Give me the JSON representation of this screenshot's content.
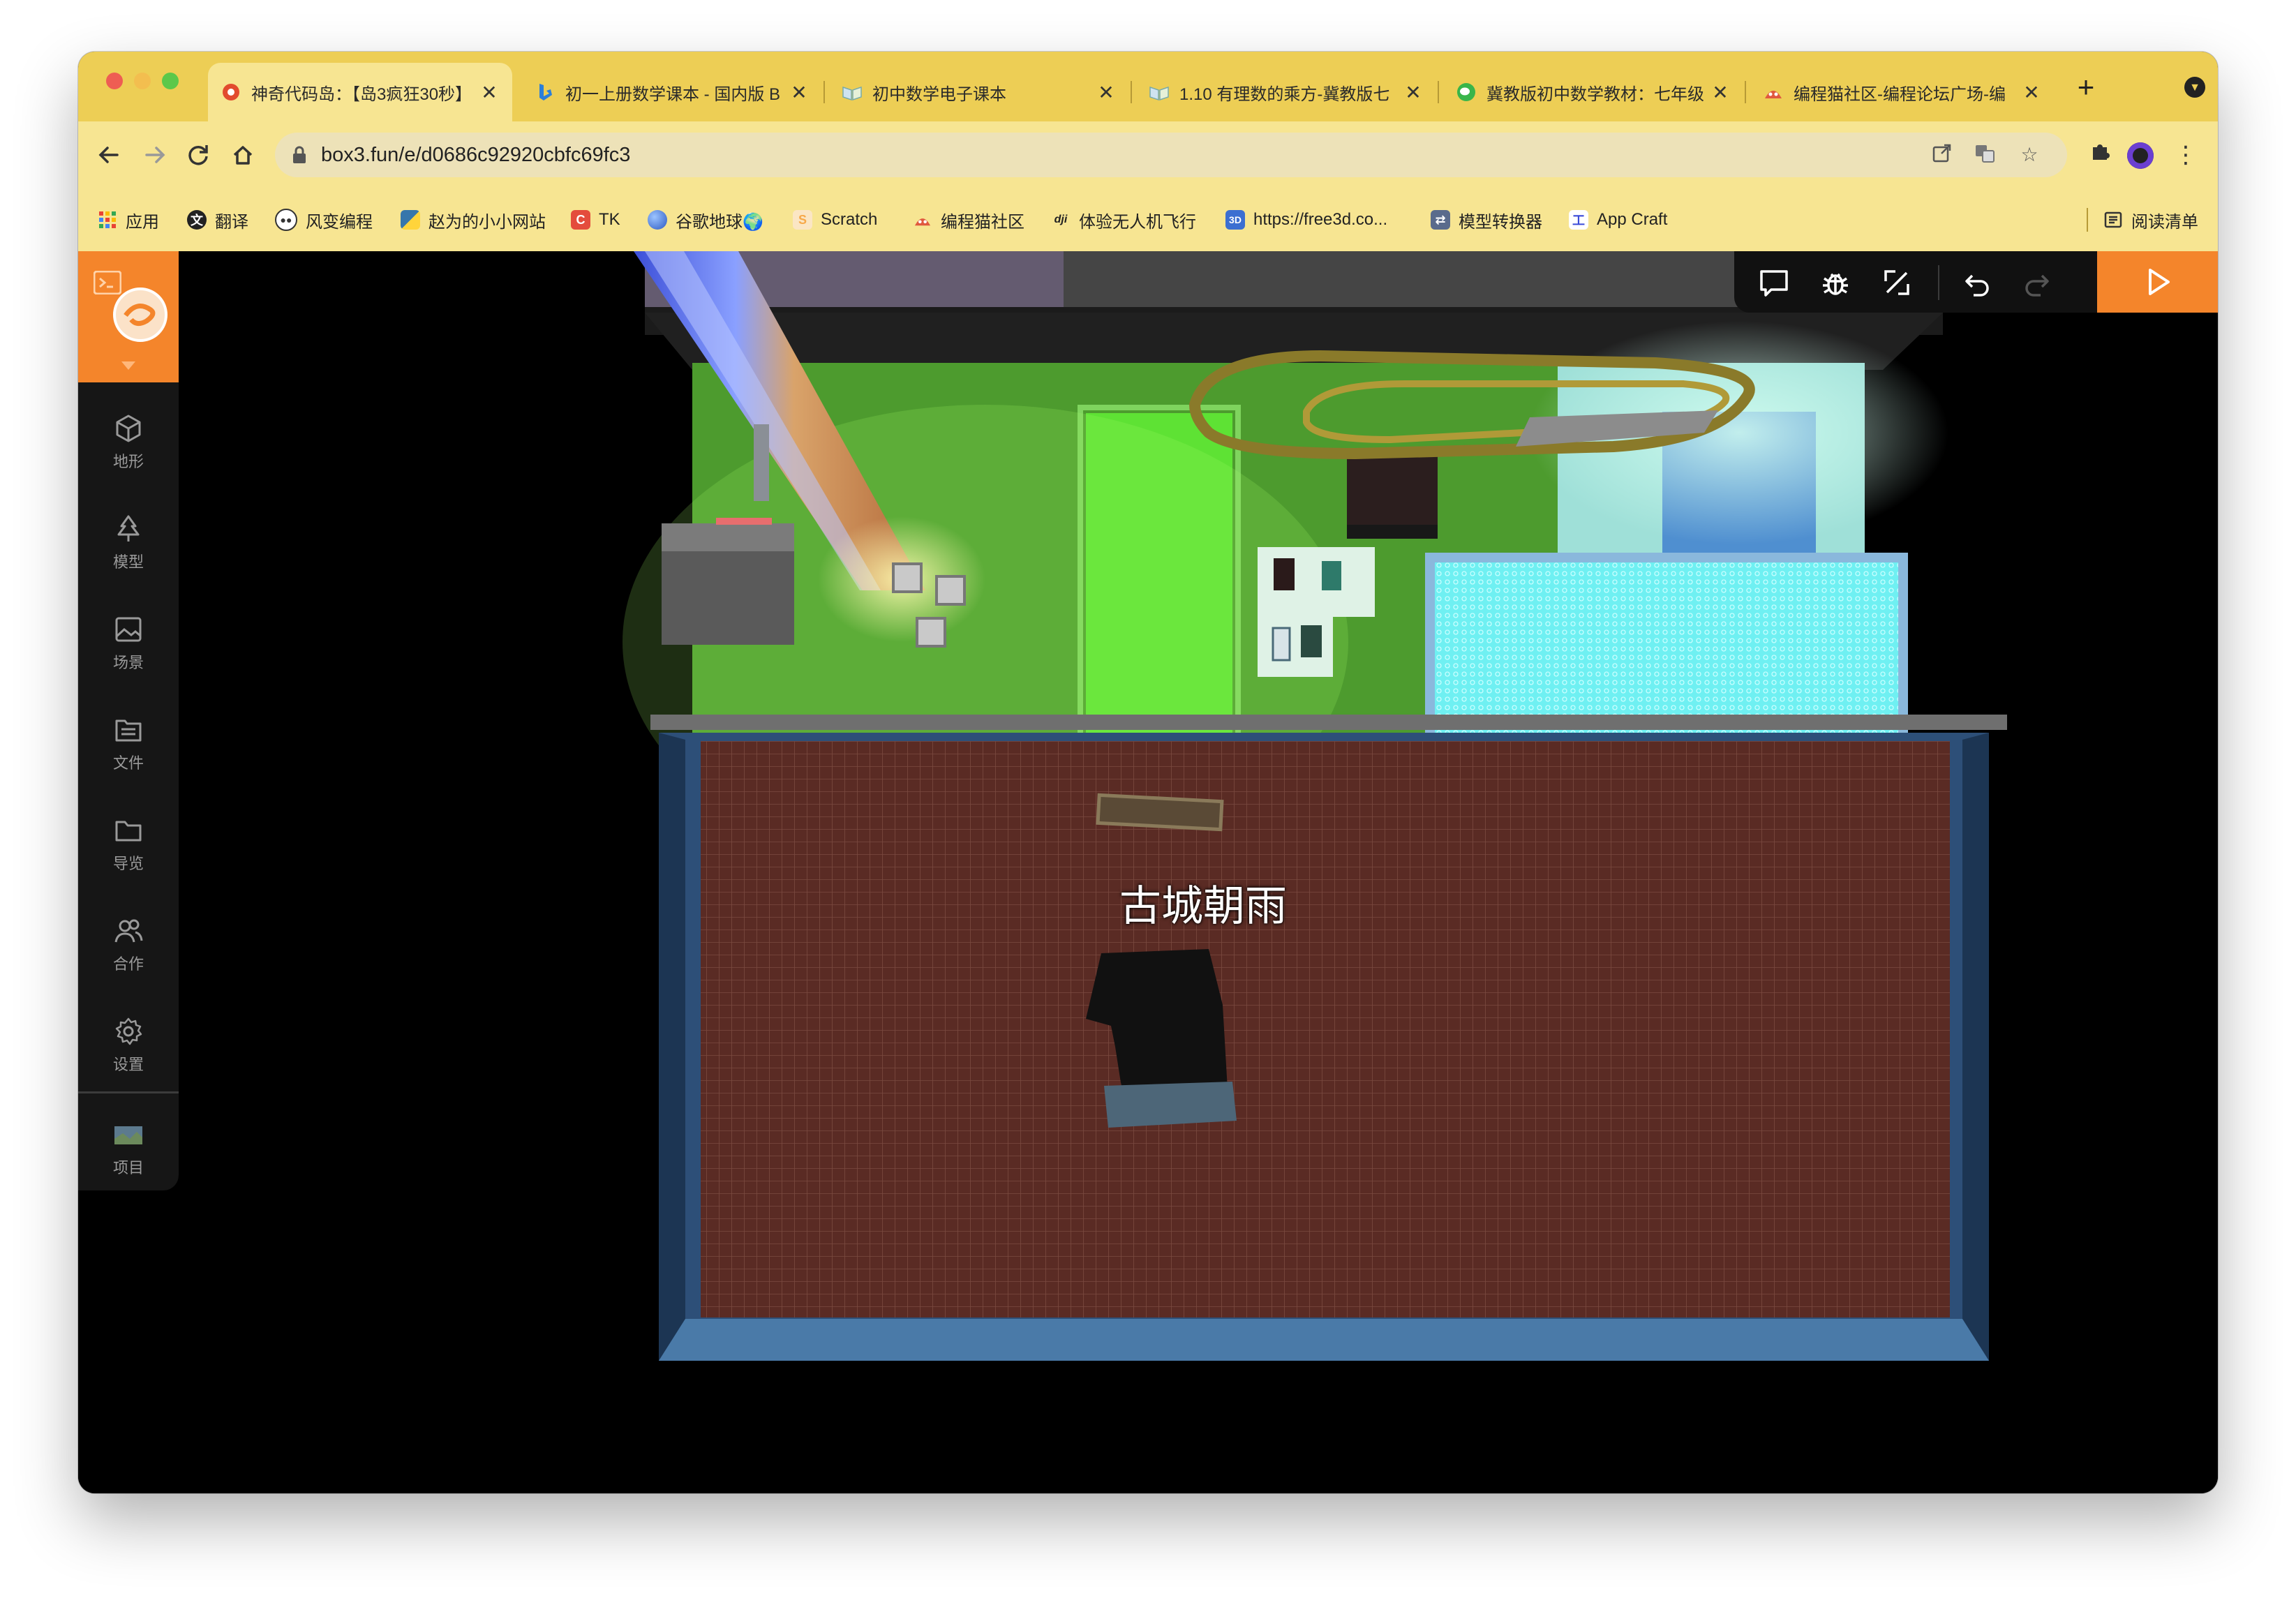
{
  "browser": {
    "tabs": [
      {
        "title": "神奇代码岛：【岛3疯狂30秒】",
        "icon": "gear-flower-icon",
        "active": true
      },
      {
        "title": "初一上册数学课本 - 国内版 B",
        "icon": "bing-icon",
        "active": false
      },
      {
        "title": "初中数学电子课本",
        "icon": "book-icon",
        "active": false
      },
      {
        "title": "1.10 有理数的乘方-冀教版七",
        "icon": "book-icon",
        "active": false
      },
      {
        "title": "冀教版初中数学教材：七年级",
        "icon": "wechat-icon",
        "active": false
      },
      {
        "title": "编程猫社区-编程论坛广场-编",
        "icon": "codemao-icon",
        "active": false
      }
    ],
    "new_tab": "+",
    "url": "box3.fun/e/d0686c92920cbfc69fc3",
    "bookmarks": [
      {
        "label": "应用",
        "icon": "apps-grid-icon",
        "color": "#4285f4"
      },
      {
        "label": "翻译",
        "icon": "translate-icon",
        "color": "#222222"
      },
      {
        "label": "风变编程",
        "icon": "panda-icon",
        "color": "#333333"
      },
      {
        "label": "赵为的小小网站",
        "icon": "python-icon",
        "color": "#3776ab"
      },
      {
        "label": "TK",
        "icon": "c-icon",
        "color": "#e44c3c"
      },
      {
        "label": "谷歌地球🌍",
        "icon": "earth-icon",
        "color": "#3b6fd8"
      },
      {
        "label": "Scratch",
        "icon": "scratch-icon",
        "color": "#f7a94a"
      },
      {
        "label": "编程猫社区",
        "icon": "codemao-icon",
        "color": "#e0593f"
      },
      {
        "label": "体验无人机飞行",
        "icon": "dji-icon",
        "color": "#222222"
      },
      {
        "label": "https://free3d.co...",
        "icon": "free3d-icon",
        "color": "#3c6fd1"
      },
      {
        "label": "模型转换器",
        "icon": "converter-icon",
        "color": "#5a6b8c"
      },
      {
        "label": "App Craft",
        "icon": "appcraft-icon",
        "color": "#3b4bd8"
      }
    ],
    "reading_list": "阅读清单"
  },
  "editor": {
    "sidebar": [
      {
        "label": "地形",
        "icon": "cube-icon"
      },
      {
        "label": "模型",
        "icon": "tree-icon"
      },
      {
        "label": "场景",
        "icon": "image-icon"
      },
      {
        "label": "文件",
        "icon": "file-icon"
      },
      {
        "label": "导览",
        "icon": "folder-icon"
      },
      {
        "label": "合作",
        "icon": "users-icon"
      },
      {
        "label": "设置",
        "icon": "settings-icon"
      },
      {
        "label": "项目",
        "icon": "project-thumbnail-icon"
      }
    ],
    "toolbar": [
      "chat-icon",
      "debug-bug-icon",
      "resize-icon",
      "undo-icon",
      "redo-icon"
    ],
    "run": "play-icon"
  },
  "scene": {
    "player_name": "古城朝雨"
  },
  "colors": {
    "chrome_bar": "#edce55",
    "chrome_toolbar": "#f7e592",
    "accent": "#f4852b",
    "sidebar_bg": "#161616",
    "floor": "#5a2b24",
    "grass": "#5fcc3a"
  }
}
